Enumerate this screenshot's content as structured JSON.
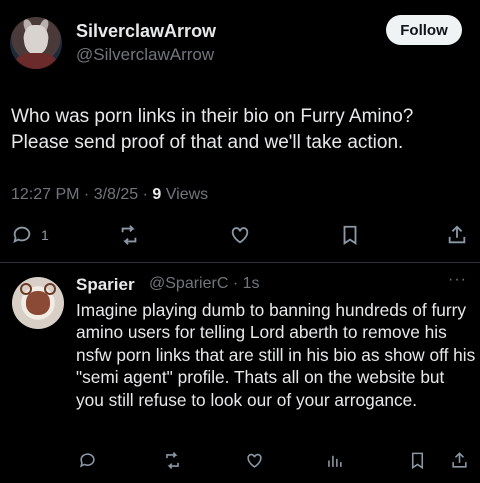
{
  "post": {
    "display_name": "SilverclawArrow",
    "handle": "@SilverclawArrow",
    "follow_label": "Follow",
    "text": "Who was porn links in their bio on Furry Amino? Please send proof of that and we'll take action.",
    "timestamp": "12:27 PM · 3/8/25 · ",
    "views_count": "9",
    "views_label": " Views",
    "reply_count": "1",
    "icons": [
      "reply-icon",
      "repost-icon",
      "like-icon",
      "bookmark-icon",
      "share-icon"
    ]
  },
  "reply": {
    "display_name": "Sparier",
    "handle_time": "@SparierC · 1s",
    "more": "···",
    "text": "Imagine playing dumb to banning hundreds of furry amino users for telling Lord aberth to remove his nsfw porn links that are still in his bio as show off his \"semi agent\" profile. Thats all on the website but you still refuse to look our of your arrogance.",
    "icons": [
      "reply-icon",
      "repost-icon",
      "like-icon",
      "views-icon",
      "bookmark-icon",
      "share-icon"
    ]
  },
  "colors": {
    "background": "#000000",
    "primary_text": "#e7e9ea",
    "secondary_text": "#71767b",
    "follow_button_bg": "#eff3f4",
    "divider": "#2f3336"
  }
}
